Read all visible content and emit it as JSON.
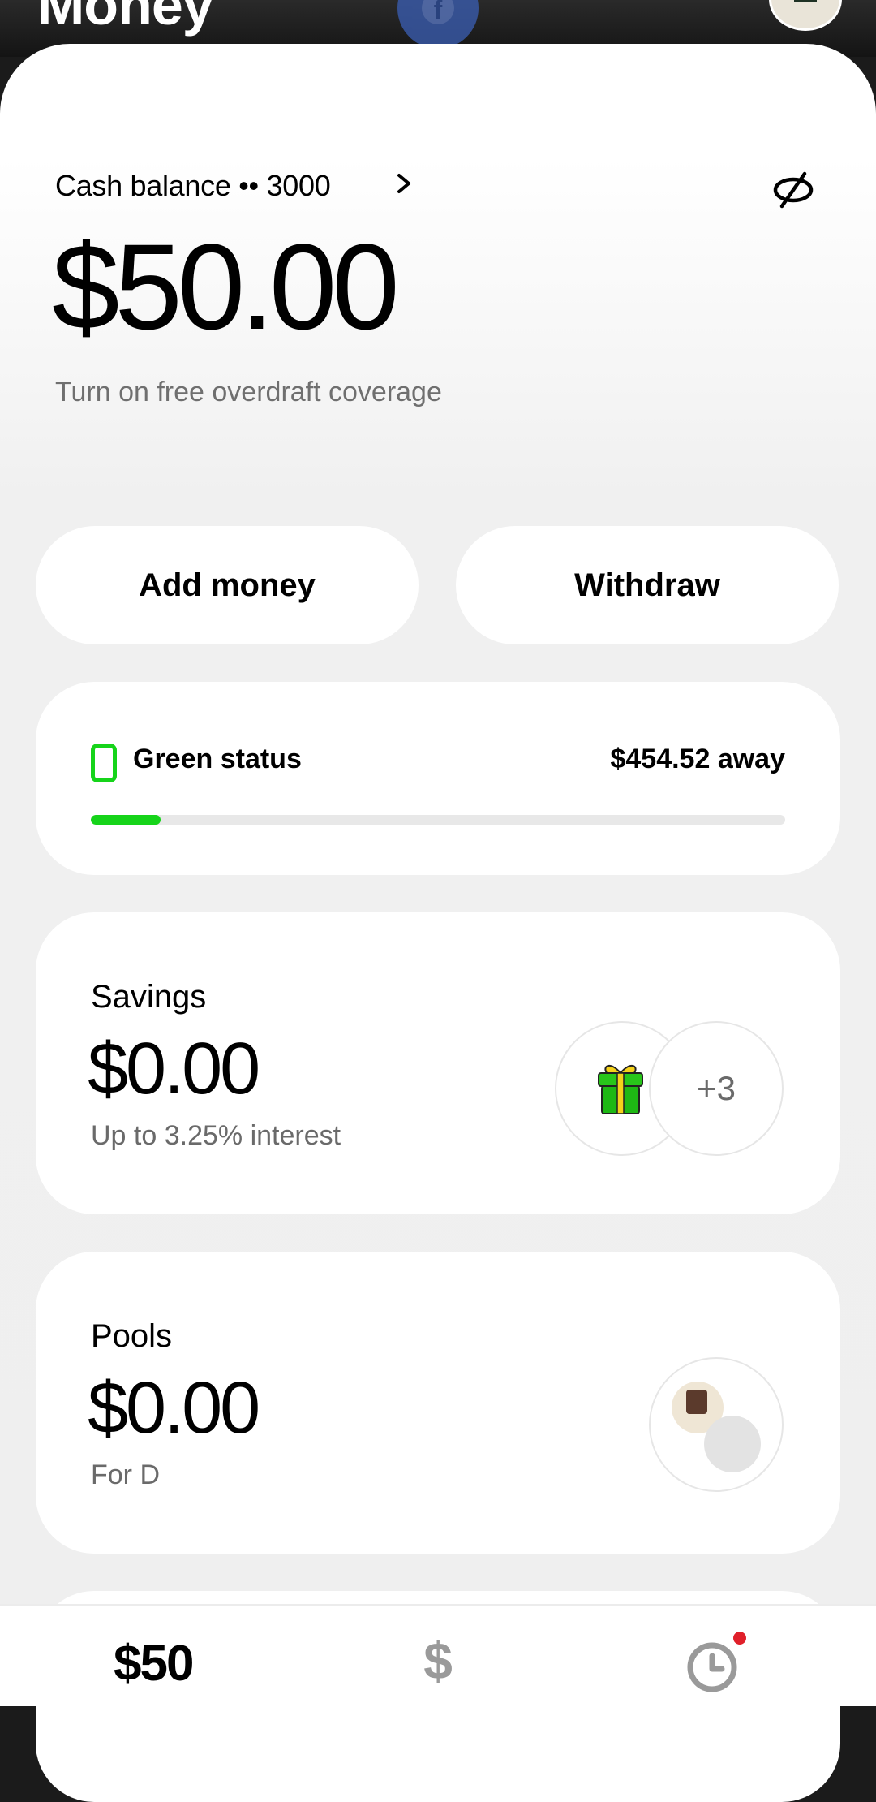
{
  "header": {
    "title": "Money"
  },
  "balance": {
    "label": "Cash balance •• 3000",
    "amount": "$50.00",
    "overdraft_text": "Turn on free overdraft coverage"
  },
  "actions": {
    "add_money": "Add money",
    "withdraw": "Withdraw"
  },
  "status": {
    "label": "Green status",
    "away": "$454.52 away",
    "progress_fraction": 0.1,
    "accent_color": "#16d41a"
  },
  "savings": {
    "title": "Savings",
    "amount": "$0.00",
    "subtitle": "Up to 3.25% interest",
    "extra_count": "+3",
    "icon": "gift-icon"
  },
  "pools": {
    "title": "Pools",
    "amount": "$0.00",
    "subtitle": "For D"
  },
  "bottom_nav": {
    "balance_tab": "$50",
    "pay_tab_icon": "dollar-icon",
    "activity_tab_icon": "clock-icon",
    "notification_color": "#e0202a"
  }
}
